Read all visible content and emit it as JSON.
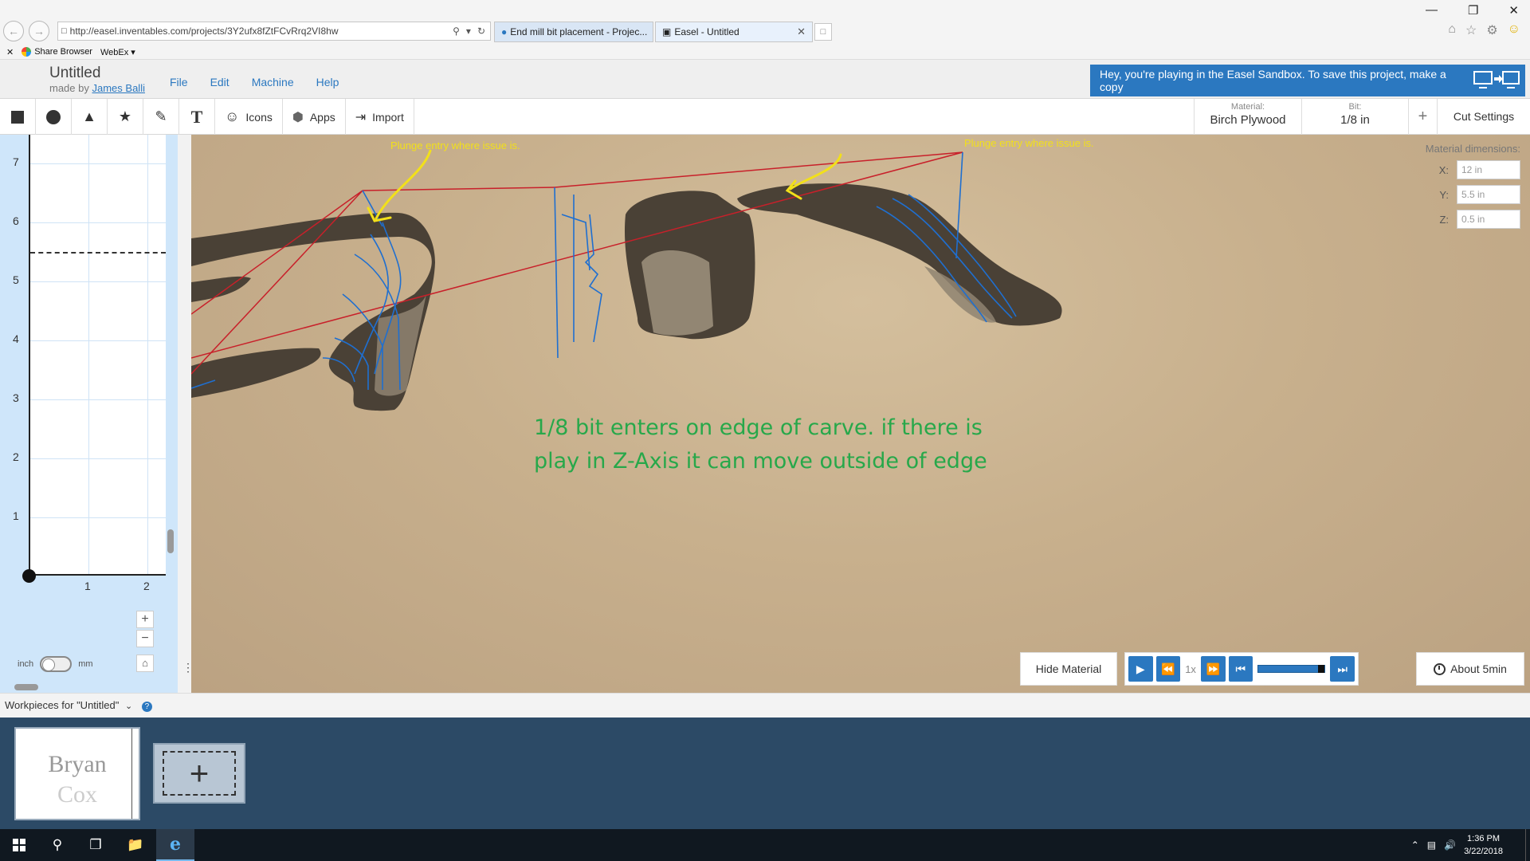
{
  "browser": {
    "url": "http://easel.inventables.com/projects/3Y2ufx8fZtFCvRrq2VI8hw",
    "tabs": [
      {
        "label": "End mill bit placement - Projec..."
      },
      {
        "label": "Easel - Untitled"
      }
    ],
    "favorites": [
      "Share Browser",
      "WebEx"
    ]
  },
  "header": {
    "project_title": "Untitled",
    "made_by_prefix": "made by",
    "author": "James Balli",
    "menu": [
      "File",
      "Edit",
      "Machine",
      "Help"
    ],
    "sandbox_notice": "Hey, you're playing in the Easel Sandbox. To save this project, make a copy"
  },
  "toolbar": {
    "icons_label": "Icons",
    "apps_label": "Apps",
    "import_label": "Import",
    "material_label": "Material:",
    "material_value": "Birch Plywood",
    "bit_label": "Bit:",
    "bit_value": "1/8 in",
    "cut_settings": "Cut Settings"
  },
  "canvas2d": {
    "y_ticks": [
      "7",
      "6",
      "5",
      "4",
      "3",
      "2",
      "1"
    ],
    "x_ticks": [
      "1",
      "2"
    ],
    "unit_left": "inch",
    "unit_right": "mm"
  },
  "preview": {
    "annotation_1": "Plunge entry where issue is.",
    "annotation_2": "Plunge entry where issue is.",
    "comment_line1": "1/8 bit enters on edge of carve.  if there is",
    "comment_line2": "play in Z-Axis it can move outside of edge",
    "material_dimensions": {
      "title": "Material dimensions:",
      "x_label": "X:",
      "x_value": "12 in",
      "y_label": "Y:",
      "y_value": "5.5 in",
      "z_label": "Z:",
      "z_value": "0.5 in"
    },
    "hide_material": "Hide Material",
    "speed": "1x",
    "progress": 1.0,
    "estimate": "About 5min"
  },
  "workpieces": {
    "label": "Workpieces for \"Untitled\"",
    "card_line1": "Bryan",
    "card_line2": "Cox"
  },
  "taskbar": {
    "time": "1:36 PM",
    "date": "3/22/2018"
  },
  "colors": {
    "accent": "#2b78c0",
    "annotation_yellow": "#f2e01a",
    "comment_green": "#27a84a",
    "toolpath_blue": "#1f6fd0",
    "travel_red": "#c8202a"
  }
}
